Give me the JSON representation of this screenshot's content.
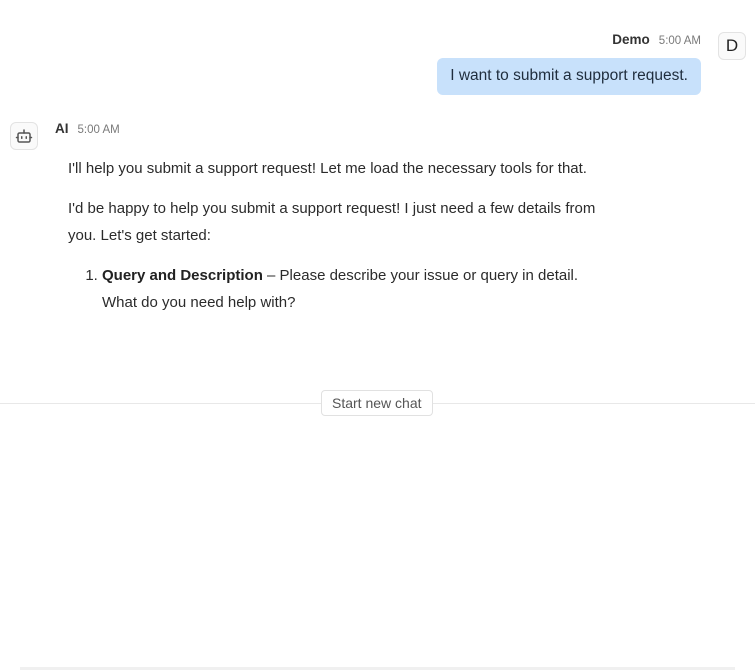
{
  "user_message": {
    "author": "Demo",
    "time": "5:00 AM",
    "avatar_letter": "D",
    "text": "I want to submit a support request."
  },
  "ai_message": {
    "author": "AI",
    "time": "5:00 AM",
    "avatar_icon": "robot-icon",
    "paragraphs": [
      "I'll help you submit a support request! Let me load the necessary tools for that.",
      "I'd be happy to help you submit a support request! I just need a few details from you. Let's get started:"
    ],
    "list": [
      {
        "title": "Query and Description",
        "text": " – Please describe your issue or query in detail. What do you need help with?"
      }
    ]
  },
  "new_chat": {
    "label": "Start new chat"
  }
}
